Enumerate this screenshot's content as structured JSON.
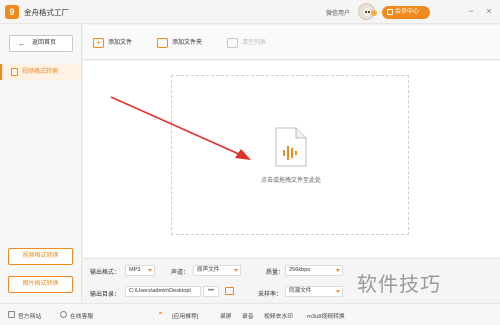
{
  "app": {
    "title": "金舟格式工厂",
    "logo_glyph": "9",
    "user_name": "微信用户",
    "member_label": "会员中心",
    "window_controls": {
      "minimize": "−",
      "close": "×"
    }
  },
  "sidebar": {
    "back_label": "返回首页",
    "back_arrow": "←",
    "active_item": "视频格式转换",
    "bottom_buttons": [
      "视频格式转换",
      "图片格式转换"
    ]
  },
  "toolbar": {
    "add_file": "添加文件",
    "add_folder": "添加文件夹",
    "clear_list": "清空列表"
  },
  "main": {
    "drop_text": "点击或拖拽文件至此处",
    "accent": "#f08a1c",
    "arrow_color": "#e0302a"
  },
  "settings": {
    "output_format_label": "输出格式：",
    "output_format_value": "MP3",
    "channel_label": "声道：",
    "channel_value": "原声文件",
    "quality_label": "质量：",
    "quality_value": "256kbps",
    "output_dir_label": "输出目录：",
    "output_dir_value": "C:\\Users\\admin\\Desktop\\",
    "dots": "•••",
    "sample_rate_label": "采样率：",
    "sample_rate_value": "同源文件"
  },
  "watermark": "软件技巧",
  "statusbar": {
    "website": "官方网站",
    "support": "在线客服",
    "recommend": "[应用推荐]",
    "screen_record": "录屏",
    "audio_record": "录音",
    "video_watermark": "视频去水印",
    "m3u8": "m3u8视频转换"
  }
}
